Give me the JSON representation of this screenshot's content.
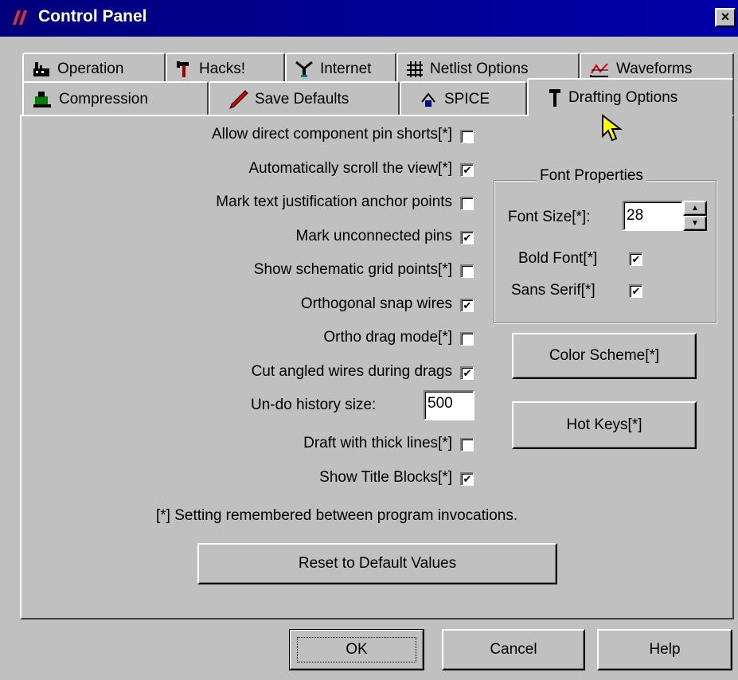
{
  "window": {
    "title": "Control Panel",
    "close_glyph": "×"
  },
  "tabs_row1": [
    {
      "label": "Operation",
      "icon": "factory-icon"
    },
    {
      "label": "Hacks!",
      "icon": "hammer-wrench-icon"
    },
    {
      "label": "Internet",
      "icon": "antenna-icon"
    },
    {
      "label": "Netlist Options",
      "icon": "grid-icon"
    },
    {
      "label": "Waveforms",
      "icon": "waveform-icon"
    }
  ],
  "tabs_row2": [
    {
      "label": "Compression",
      "icon": "compressor-icon"
    },
    {
      "label": "Save Defaults",
      "icon": "pen-icon"
    },
    {
      "label": "SPICE",
      "icon": "probe-icon"
    },
    {
      "label": "Drafting Options",
      "icon": "pushpin-icon",
      "active": true
    }
  ],
  "options": [
    {
      "label": "Allow direct component pin shorts[*]",
      "checked": false
    },
    {
      "label": "Automatically scroll the view[*]",
      "checked": true
    },
    {
      "label": "Mark text justification anchor points",
      "checked": false
    },
    {
      "label": "Mark unconnected pins",
      "checked": true
    },
    {
      "label": "Show schematic grid points[*]",
      "checked": false
    },
    {
      "label": "Orthogonal snap wires",
      "checked": true
    },
    {
      "label": "Ortho drag mode[*]",
      "checked": false
    },
    {
      "label": "Cut angled wires during drags",
      "checked": true
    }
  ],
  "undo": {
    "label": "Un-do history size:",
    "value": "500"
  },
  "options2": [
    {
      "label": "Draft with thick lines[*]",
      "checked": false
    },
    {
      "label": "Show Title Blocks[*]",
      "checked": true
    }
  ],
  "font_properties": {
    "title": "Font Properties",
    "size_label": "Font Size[*]:",
    "size_value": "28",
    "bold_label": "Bold Font[*]",
    "bold_checked": true,
    "sans_label": "Sans Serif[*]",
    "sans_checked": true
  },
  "buttons": {
    "color_scheme": "Color Scheme[*]",
    "hot_keys": "Hot Keys[*]",
    "reset": "Reset to Default Values",
    "ok": "OK",
    "cancel": "Cancel",
    "help": "Help"
  },
  "footnote": "[*] Setting remembered between program invocations.",
  "colors": {
    "titlebar": "#0000a8",
    "face": "#c0c0c0",
    "cursor": "#ffff00"
  }
}
